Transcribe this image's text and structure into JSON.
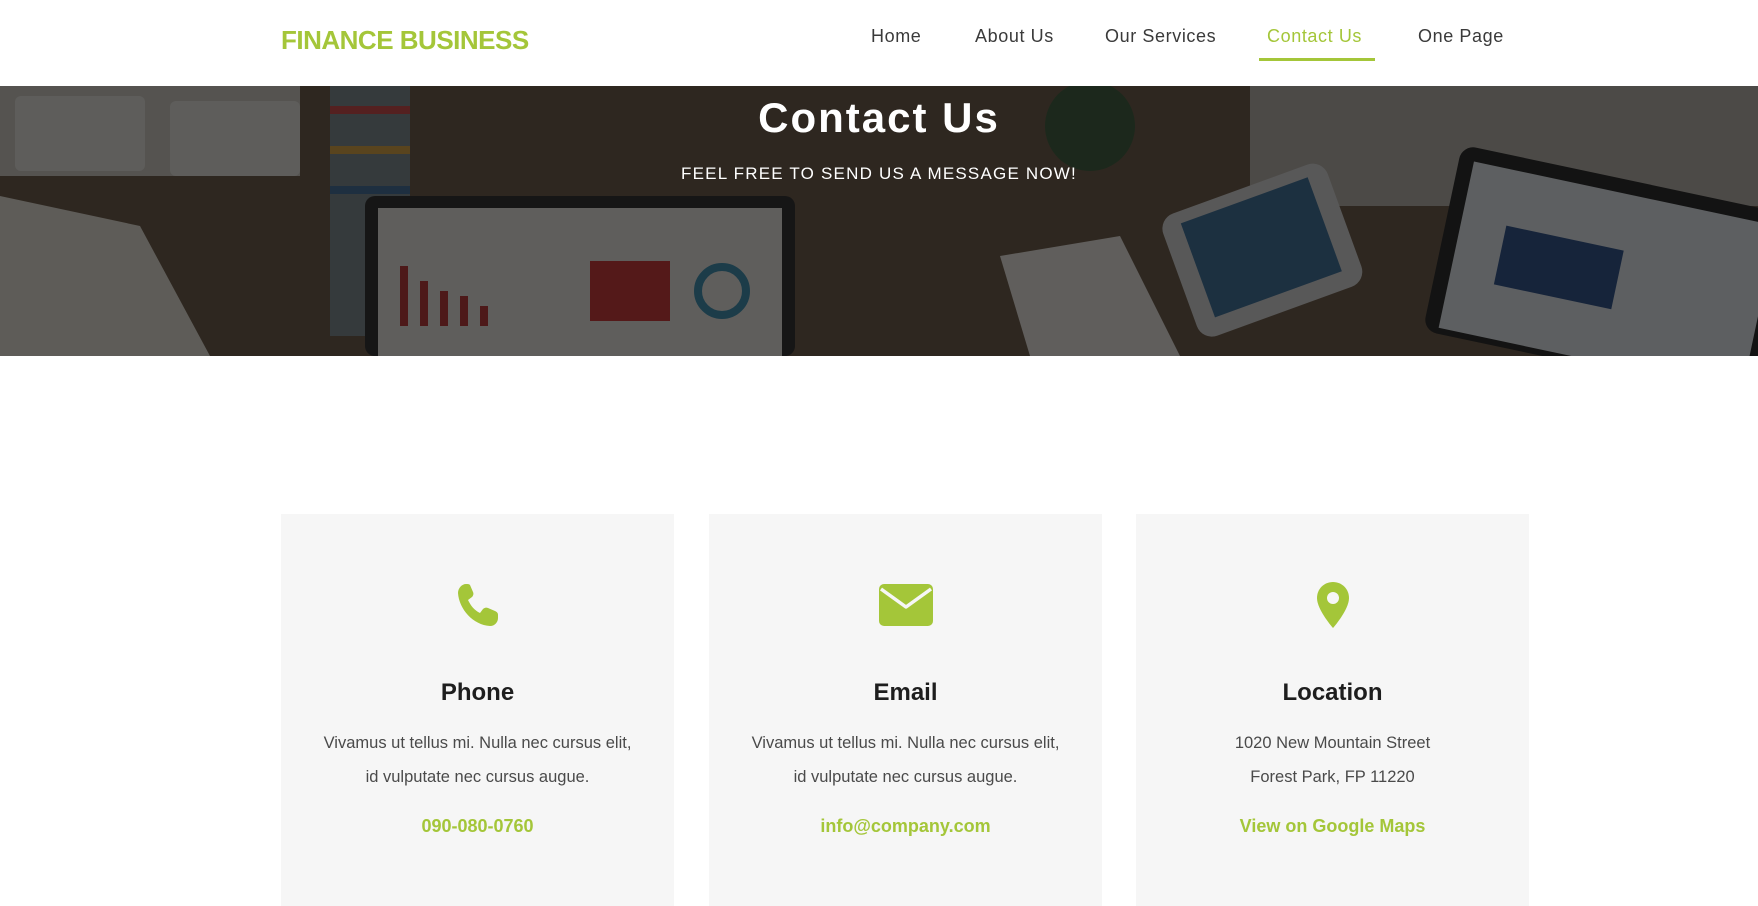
{
  "header": {
    "brand": "FINANCE BUSINESS",
    "nav": [
      {
        "label": "Home"
      },
      {
        "label": "About Us"
      },
      {
        "label": "Our Services"
      },
      {
        "label": "Contact Us",
        "active": true
      },
      {
        "label": "One Page"
      }
    ]
  },
  "hero": {
    "title": "Contact Us",
    "subtitle": "FEEL FREE TO SEND US A MESSAGE NOW!"
  },
  "cards": [
    {
      "icon": "phone-icon",
      "title": "Phone",
      "text_line1": "Vivamus ut tellus mi. Nulla nec cursus elit,",
      "text_line2": "id vulputate nec cursus augue.",
      "link": "090-080-0760"
    },
    {
      "icon": "envelope-icon",
      "title": "Email",
      "text_line1": "Vivamus ut tellus mi. Nulla nec cursus elit,",
      "text_line2": "id vulputate nec cursus augue.",
      "link": "info@company.com"
    },
    {
      "icon": "map-marker-icon",
      "title": "Location",
      "text_line1": "1020 New Mountain Street",
      "text_line2": "Forest Park, FP 11220",
      "link": "View on Google Maps"
    }
  ],
  "colors": {
    "accent": "#a4c639",
    "card_background": "#f6f6f6",
    "heading": "#1e1e1e",
    "body_text": "#4a4a4a"
  }
}
